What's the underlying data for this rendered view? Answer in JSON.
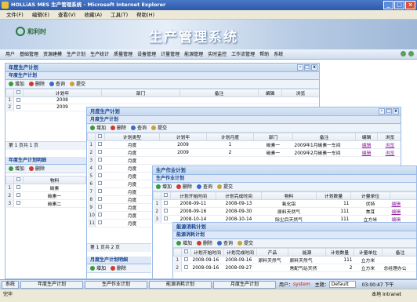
{
  "browser": {
    "title": "HOLLiAS MES 生产管理系统 - Microsoft Internet Explorer",
    "menu": [
      "文件(F)",
      "编辑(E)",
      "查看(V)",
      "收藏(A)",
      "工具(T)",
      "帮助(H)"
    ],
    "status_left": "完毕",
    "status_right": "本地 Intranet"
  },
  "banner": {
    "logo_text": "和利时",
    "title": "生产管理系统"
  },
  "nav": [
    "用户",
    "基础管理",
    "资源建模",
    "生产计划",
    "生产统计",
    "质量管理",
    "设备管理",
    "计量管理",
    "能源管理",
    "实时监控",
    "工作流管理",
    "帮助",
    "系统"
  ],
  "win1": {
    "title": "年度生产计划",
    "sub": "年度生产计划",
    "toolbar": [
      "增加",
      "删除",
      "查询",
      "提交"
    ],
    "cols": [
      "",
      "",
      "计划年",
      "部门",
      "备注",
      "编辑",
      "浏览"
    ],
    "rows": [
      [
        "1",
        "2008"
      ],
      [
        "2",
        "2009"
      ]
    ],
    "pager": "第 1 页共 1 页",
    "detail_title": "年度生产计划明细",
    "detail_toolbar": [
      "增加",
      "删除"
    ],
    "detail_cols": [
      "",
      "",
      "物料"
    ],
    "detail_rows": [
      [
        "1",
        "碳素"
      ],
      [
        "2",
        "碳素一"
      ],
      [
        "3",
        "碳素二"
      ]
    ]
  },
  "win2": {
    "title": "月度生产计划",
    "sub": "月度生产计划",
    "toolbar": [
      "增加",
      "删除",
      "查询",
      "提交"
    ],
    "cols": [
      "",
      "",
      "计划类型",
      "计划年",
      "计划月度",
      "部门",
      "备注",
      "编辑",
      "浏览"
    ],
    "rows": [
      [
        "1",
        "月度",
        "2009",
        "1",
        "碳素一",
        "2009年1月碳素一车间",
        "编辑",
        "浏览"
      ],
      [
        "2",
        "月度",
        "2009",
        "2",
        "碳素一",
        "2009年2月碳素一车间",
        "编辑",
        "浏览"
      ],
      [
        "3",
        "月度"
      ],
      [
        "4",
        "月度"
      ],
      [
        "5",
        "月度"
      ],
      [
        "6",
        "月度"
      ],
      [
        "7",
        "月度"
      ],
      [
        "8",
        "月度"
      ],
      [
        "9",
        "月度"
      ],
      [
        "10",
        "月度"
      ],
      [
        "11",
        "月度"
      ]
    ],
    "pager": "第 1 页共 2 页",
    "detail_title": "月度生产计划明细",
    "detail_toolbar": [
      "增加",
      "删除"
    ]
  },
  "win3": {
    "title": "生产作业计划",
    "sub": "生产作业计划",
    "toolbar": [
      "增加",
      "删除",
      "查询",
      "提交"
    ],
    "cols": [
      "",
      "",
      "计划开始时间",
      "计划完成时间",
      "物料",
      "计划数量",
      "计量单位",
      ""
    ],
    "rows": [
      [
        "1",
        "2008-09-11",
        "2008-09-13",
        "氧化铝",
        "11",
        "伏特",
        "编辑"
      ],
      [
        "2",
        "2008-09-16",
        "2008-09-30",
        "原料天然气",
        "111",
        "焦耳",
        "编辑"
      ],
      [
        "3",
        "2008-10-14",
        "2008-10-14",
        "除尘后天然气",
        "111",
        "立方米",
        "编辑"
      ]
    ]
  },
  "win4": {
    "title": "能源消耗计划",
    "sub": "能源消耗计划",
    "toolbar": [
      "增加",
      "删除",
      "查询",
      "提交"
    ],
    "cols": [
      "",
      "",
      "计划开始时间",
      "计划完成时间",
      "产品",
      "能源",
      "计划数量",
      "计量单位",
      "备注"
    ],
    "rows": [
      [
        "1",
        "2008-09-16",
        "2008-09-16",
        "原料天然气",
        "原料天然气",
        "111",
        "立方米",
        ""
      ],
      [
        "2",
        "2008-09-16",
        "2008-09-27",
        "",
        "常配气站天然",
        "2",
        "立方米",
        "总经理办公"
      ]
    ]
  },
  "taskbar": {
    "system": "系统",
    "tabs": [
      "年度生产计划",
      "生产作业计划",
      "能源消耗计划",
      "月度生产计划"
    ],
    "user_label": "用户：",
    "user": "system",
    "theme_label": "主题：",
    "theme": "Default",
    "time": "03:00:47 下午"
  }
}
